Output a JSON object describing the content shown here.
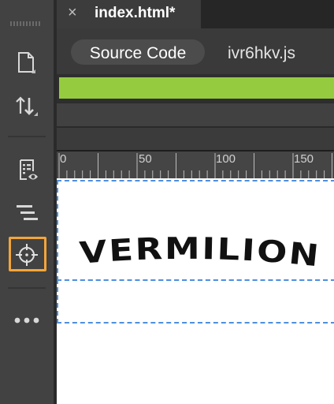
{
  "document_tab": {
    "close_glyph": "×",
    "filename": "index.html*"
  },
  "related_files": {
    "source_code_label": "Source Code",
    "js_file_label": "ivr6hkv.js"
  },
  "ruler": {
    "labels": [
      "0",
      "50",
      "100",
      "150"
    ]
  },
  "canvas": {
    "brand_text": "VERMILION"
  },
  "toolbar": {
    "tools": [
      {
        "name": "file-icon"
      },
      {
        "name": "transfer-arrows-icon"
      },
      {
        "name": "live-view-inspect-icon"
      },
      {
        "name": "align-lines-icon"
      },
      {
        "name": "target-crosshair-icon",
        "selected": true
      },
      {
        "name": "more-options-icon"
      }
    ]
  },
  "colors": {
    "accent_selected": "#f3a53a",
    "highlight_bar": "#95cc3f",
    "selection_dash": "#4d8fe0"
  }
}
